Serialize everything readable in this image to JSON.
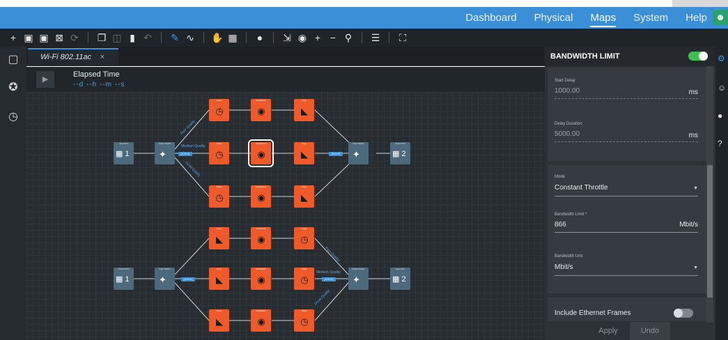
{
  "nav": {
    "items": [
      "Dashboard",
      "Physical",
      "Maps",
      "System",
      "Help"
    ],
    "active": "Maps"
  },
  "toolbar": {
    "icons": [
      "add-icon",
      "save-icon",
      "save-as-icon",
      "export-icon",
      "refresh-icon",
      "copy-icon",
      "paste-icon",
      "delete-icon",
      "undo-icon",
      "pencil-icon",
      "line-icon",
      "hand-icon",
      "select-icon",
      "toggle-icon",
      "fit-icon",
      "target-icon",
      "zoom-in-icon",
      "zoom-out-icon",
      "search-icon",
      "menu-icon",
      "fullscreen-icon"
    ]
  },
  "tab": {
    "label": "Wi-Fi 802.11ac",
    "close": "×"
  },
  "elapsed": {
    "title": "Elapsed Time",
    "value": "--d --h --m --s"
  },
  "canvas": {
    "quality_labels": [
      "Poor Quality",
      "Medium Quality",
      "Good Quality",
      "Poor Quality",
      "Medium Quality",
      "Good Quality"
    ],
    "badges": [
      "[XXXX]",
      "[XXXX]",
      "[XXXX]",
      "[XXXX]"
    ],
    "port_numbers": [
      "1",
      "2",
      "1",
      "2"
    ]
  },
  "panel": {
    "title": "BANDWIDTH LIMIT",
    "enabled": true,
    "start_delay": {
      "label": "Start Delay",
      "value": "1000.00",
      "unit": "ms"
    },
    "delay_duration": {
      "label": "Delay Duration",
      "value": "5000.00",
      "unit": "ms"
    },
    "mode": {
      "label": "Mode",
      "value": "Constant Throttle"
    },
    "bandwidth_limit": {
      "label": "Bandwidth Limit *",
      "value": "866",
      "unit": "Mbit/s"
    },
    "bandwidth_unit": {
      "label": "Bandwidth Unit",
      "value": "Mbit/s"
    },
    "include_ethernet": {
      "label": "Include Ethernet Frames",
      "enabled": false
    },
    "apply": "Apply",
    "undo": "Undo"
  },
  "colors": {
    "nav": "#3a8fd6",
    "toolbar": "#1f2428",
    "canvas": "#272d31",
    "node_orange": "#ef5a2a",
    "switch_blue": "#4d6a7d",
    "toggle_on": "#3dc14f",
    "toggle_off": "#80878c"
  }
}
